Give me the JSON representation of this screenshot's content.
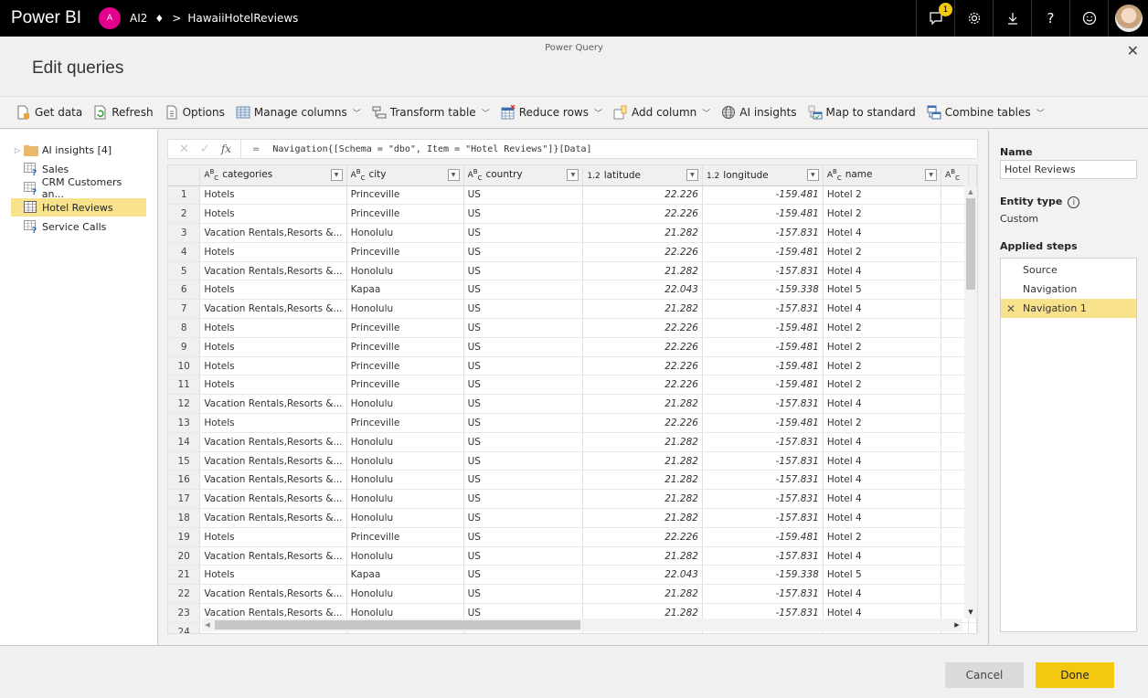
{
  "topbar": {
    "app_name": "Power BI",
    "workspace_initial": "A",
    "workspace_name": "AI2",
    "breadcrumb_separator": ">",
    "report_name": "HawaiiHotelReviews",
    "notification_count": "1",
    "icons": [
      "notifications-icon",
      "settings-icon",
      "download-icon",
      "help-icon",
      "feedback-smiley-icon",
      "user-profile-picture"
    ],
    "help_glyph": "?"
  },
  "dialog": {
    "window_title": "Power Query",
    "heading": "Edit queries",
    "close_glyph": "✕"
  },
  "ribbon": {
    "items": [
      {
        "label": "Get data",
        "icon": "get-data-icon",
        "dropdown": false
      },
      {
        "label": "Refresh",
        "icon": "refresh-icon",
        "dropdown": false
      },
      {
        "label": "Options",
        "icon": "options-icon",
        "dropdown": false
      },
      {
        "label": "Manage columns",
        "icon": "manage-columns-icon",
        "dropdown": true
      },
      {
        "label": "Transform table",
        "icon": "transform-table-icon",
        "dropdown": true
      },
      {
        "label": "Reduce rows",
        "icon": "reduce-rows-icon",
        "dropdown": true
      },
      {
        "label": "Add column",
        "icon": "add-column-icon",
        "dropdown": true
      },
      {
        "label": "AI insights",
        "icon": "ai-insights-icon",
        "dropdown": false
      },
      {
        "label": "Map to standard",
        "icon": "map-to-standard-icon",
        "dropdown": false
      },
      {
        "label": "Combine tables",
        "icon": "combine-tables-icon",
        "dropdown": true
      }
    ]
  },
  "queries": {
    "items": [
      {
        "label": "AI insights [4]",
        "type": "folder",
        "selected": false
      },
      {
        "label": "Sales",
        "type": "table-unknown",
        "selected": false
      },
      {
        "label": "CRM Customers an...",
        "type": "table-unknown",
        "selected": false
      },
      {
        "label": "Hotel Reviews",
        "type": "table",
        "selected": true
      },
      {
        "label": "Service Calls",
        "type": "table-unknown",
        "selected": false
      }
    ]
  },
  "formula_bar": {
    "equals": "=",
    "formula": "Navigation{[Schema = \"dbo\", Item = \"Hotel Reviews\"]}[Data]"
  },
  "grid": {
    "columns": [
      {
        "type": "ABC",
        "name": "categories"
      },
      {
        "type": "ABC",
        "name": "city"
      },
      {
        "type": "ABC",
        "name": "country"
      },
      {
        "type": "1.2",
        "name": "latitude"
      },
      {
        "type": "1.2",
        "name": "longitude"
      },
      {
        "type": "ABC",
        "name": "name"
      },
      {
        "type": "ABC",
        "name": ""
      }
    ],
    "rows": [
      [
        "1",
        "Hotels",
        "Princeville",
        "US",
        "22.226",
        "-159.481",
        "Hotel 2"
      ],
      [
        "2",
        "Hotels",
        "Princeville",
        "US",
        "22.226",
        "-159.481",
        "Hotel 2"
      ],
      [
        "3",
        "Vacation Rentals,Resorts &...",
        "Honolulu",
        "US",
        "21.282",
        "-157.831",
        "Hotel 4"
      ],
      [
        "4",
        "Hotels",
        "Princeville",
        "US",
        "22.226",
        "-159.481",
        "Hotel 2"
      ],
      [
        "5",
        "Vacation Rentals,Resorts &...",
        "Honolulu",
        "US",
        "21.282",
        "-157.831",
        "Hotel 4"
      ],
      [
        "6",
        "Hotels",
        "Kapaa",
        "US",
        "22.043",
        "-159.338",
        "Hotel 5"
      ],
      [
        "7",
        "Vacation Rentals,Resorts &...",
        "Honolulu",
        "US",
        "21.282",
        "-157.831",
        "Hotel 4"
      ],
      [
        "8",
        "Hotels",
        "Princeville",
        "US",
        "22.226",
        "-159.481",
        "Hotel 2"
      ],
      [
        "9",
        "Hotels",
        "Princeville",
        "US",
        "22.226",
        "-159.481",
        "Hotel 2"
      ],
      [
        "10",
        "Hotels",
        "Princeville",
        "US",
        "22.226",
        "-159.481",
        "Hotel 2"
      ],
      [
        "11",
        "Hotels",
        "Princeville",
        "US",
        "22.226",
        "-159.481",
        "Hotel 2"
      ],
      [
        "12",
        "Vacation Rentals,Resorts &...",
        "Honolulu",
        "US",
        "21.282",
        "-157.831",
        "Hotel 4"
      ],
      [
        "13",
        "Hotels",
        "Princeville",
        "US",
        "22.226",
        "-159.481",
        "Hotel 2"
      ],
      [
        "14",
        "Vacation Rentals,Resorts &...",
        "Honolulu",
        "US",
        "21.282",
        "-157.831",
        "Hotel 4"
      ],
      [
        "15",
        "Vacation Rentals,Resorts &...",
        "Honolulu",
        "US",
        "21.282",
        "-157.831",
        "Hotel 4"
      ],
      [
        "16",
        "Vacation Rentals,Resorts &...",
        "Honolulu",
        "US",
        "21.282",
        "-157.831",
        "Hotel 4"
      ],
      [
        "17",
        "Vacation Rentals,Resorts &...",
        "Honolulu",
        "US",
        "21.282",
        "-157.831",
        "Hotel 4"
      ],
      [
        "18",
        "Vacation Rentals,Resorts &...",
        "Honolulu",
        "US",
        "21.282",
        "-157.831",
        "Hotel 4"
      ],
      [
        "19",
        "Hotels",
        "Princeville",
        "US",
        "22.226",
        "-159.481",
        "Hotel 2"
      ],
      [
        "20",
        "Vacation Rentals,Resorts &...",
        "Honolulu",
        "US",
        "21.282",
        "-157.831",
        "Hotel 4"
      ],
      [
        "21",
        "Hotels",
        "Kapaa",
        "US",
        "22.043",
        "-159.338",
        "Hotel 5"
      ],
      [
        "22",
        "Vacation Rentals,Resorts &...",
        "Honolulu",
        "US",
        "21.282",
        "-157.831",
        "Hotel 4"
      ],
      [
        "23",
        "Vacation Rentals,Resorts &...",
        "Honolulu",
        "US",
        "21.282",
        "-157.831",
        "Hotel 4"
      ],
      [
        "24",
        "",
        "",
        "",
        "",
        "",
        ""
      ]
    ]
  },
  "properties": {
    "name_label": "Name",
    "name_value": "Hotel Reviews",
    "entity_type_label": "Entity type",
    "entity_type_value": "Custom",
    "applied_steps_label": "Applied steps",
    "steps": [
      {
        "label": "Source",
        "selected": false
      },
      {
        "label": "Navigation",
        "selected": false
      },
      {
        "label": "Navigation 1",
        "selected": true
      }
    ]
  },
  "footer": {
    "cancel_label": "Cancel",
    "done_label": "Done"
  },
  "colors": {
    "accent_yellow": "#f2c811",
    "selection_yellow": "#f9e28c",
    "workspace_pink": "#e3008c",
    "topbar_black": "#000000"
  }
}
